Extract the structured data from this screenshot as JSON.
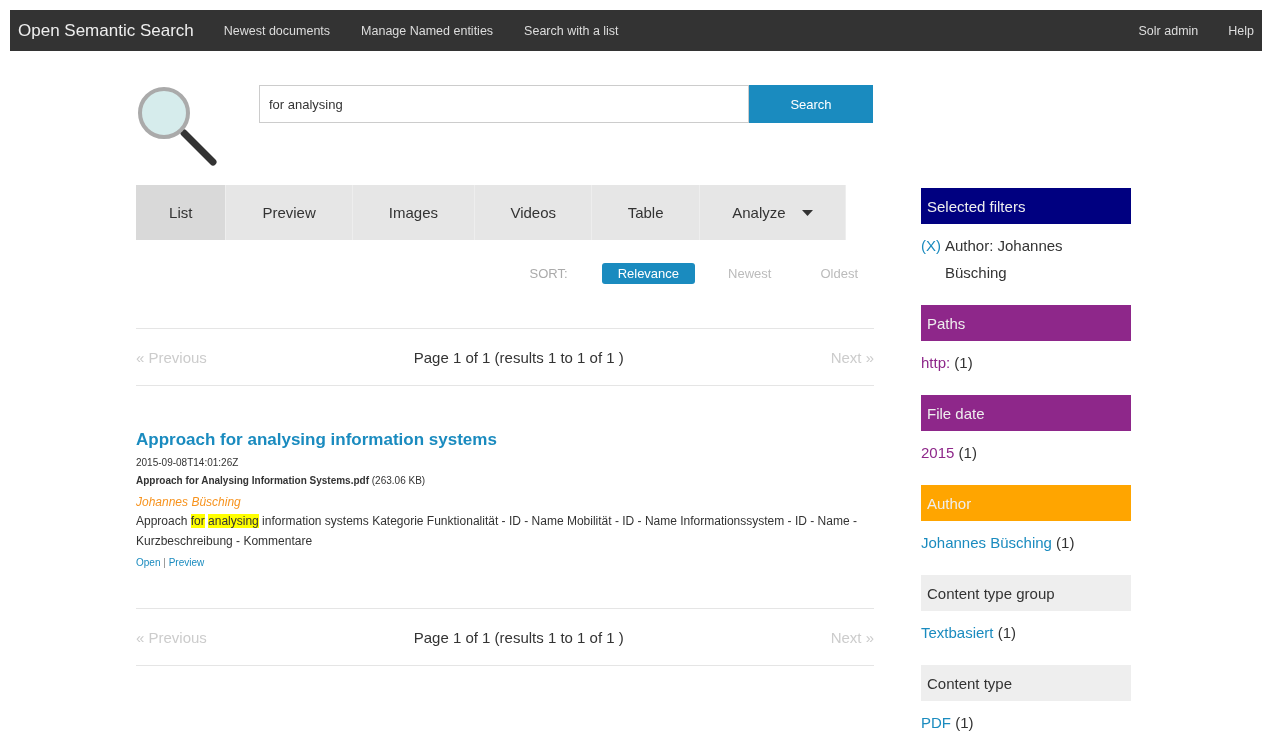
{
  "navbar": {
    "brand": "Open Semantic Search",
    "links": [
      "Newest documents",
      "Manage Named entities",
      "Search with a list"
    ],
    "right_links": [
      "Solr admin",
      "Help"
    ]
  },
  "search": {
    "value": "for analysing",
    "button": "Search"
  },
  "tabs": [
    {
      "label": "List",
      "selected": true,
      "kind": "plain"
    },
    {
      "label": "Preview",
      "selected": false,
      "kind": "plain"
    },
    {
      "label": "Images",
      "selected": false,
      "kind": "plain"
    },
    {
      "label": "Videos",
      "selected": false,
      "kind": "plain"
    },
    {
      "label": "Table",
      "selected": false,
      "kind": "plain"
    },
    {
      "label": "Analyze",
      "selected": false,
      "kind": "dropdown"
    }
  ],
  "sort": {
    "label": "SORT:",
    "options": [
      {
        "label": "Relevance",
        "selected": true
      },
      {
        "label": "Newest",
        "selected": false
      },
      {
        "label": "Oldest",
        "selected": false
      }
    ]
  },
  "pagers": [
    {
      "previous": "« Previous",
      "previous_disabled": true,
      "info": "Page 1 of 1 (results 1 to 1 of 1 )",
      "next": "Next »",
      "next_disabled": true
    },
    {
      "previous": "« Previous",
      "previous_disabled": true,
      "info": "Page 1 of 1 (results 1 to 1 of 1 )",
      "next": "Next »",
      "next_disabled": true
    }
  ],
  "results": [
    {
      "title": "Approach for analysing information systems",
      "date": "2015-09-08T14:01:26Z",
      "filename": "Approach for Analysing Information Systems.pdf",
      "size": "(263.06 KB)",
      "author": "Johannes Büsching",
      "snippet": [
        {
          "text": "Approach ",
          "highlighted": false
        },
        {
          "text": "for",
          "highlighted": true
        },
        {
          "text": "analysing",
          "highlighted": true
        },
        {
          "text": " information systems Kategorie Funktionalität - ID - Name Mobilität - ID - Name Informationssystem - ID - Name - Kurzbeschreibung - Kommentare",
          "highlighted": false
        }
      ],
      "actions": [
        "Open",
        "Preview"
      ],
      "action_separator": "|"
    }
  ],
  "selected_filters": {
    "title": "Selected filters",
    "color": "#000080",
    "items": [
      {
        "remove": "(X)",
        "text": "Author: Johannes Büsching"
      }
    ]
  },
  "facets": [
    {
      "title": "Paths",
      "color": "#8e278a",
      "items": [
        {
          "label": "http:",
          "count": "(1)",
          "visited": true
        }
      ]
    },
    {
      "title": "File date",
      "color": "#8e278a",
      "items": [
        {
          "label": "2015",
          "count": "(1)",
          "visited": true
        }
      ]
    },
    {
      "title": "Author",
      "color": "#ffa500",
      "items": [
        {
          "label": "Johannes Büsching",
          "count": "(1)",
          "visited": false
        }
      ]
    },
    {
      "title": "Content type group",
      "color": "#eeeeee",
      "items": [
        {
          "label": "Textbasiert",
          "count": "(1)",
          "visited": false
        }
      ]
    },
    {
      "title": "Content type",
      "color": "#eeeeee",
      "items": [
        {
          "label": "PDF",
          "count": "(1)",
          "visited": false
        }
      ]
    }
  ]
}
